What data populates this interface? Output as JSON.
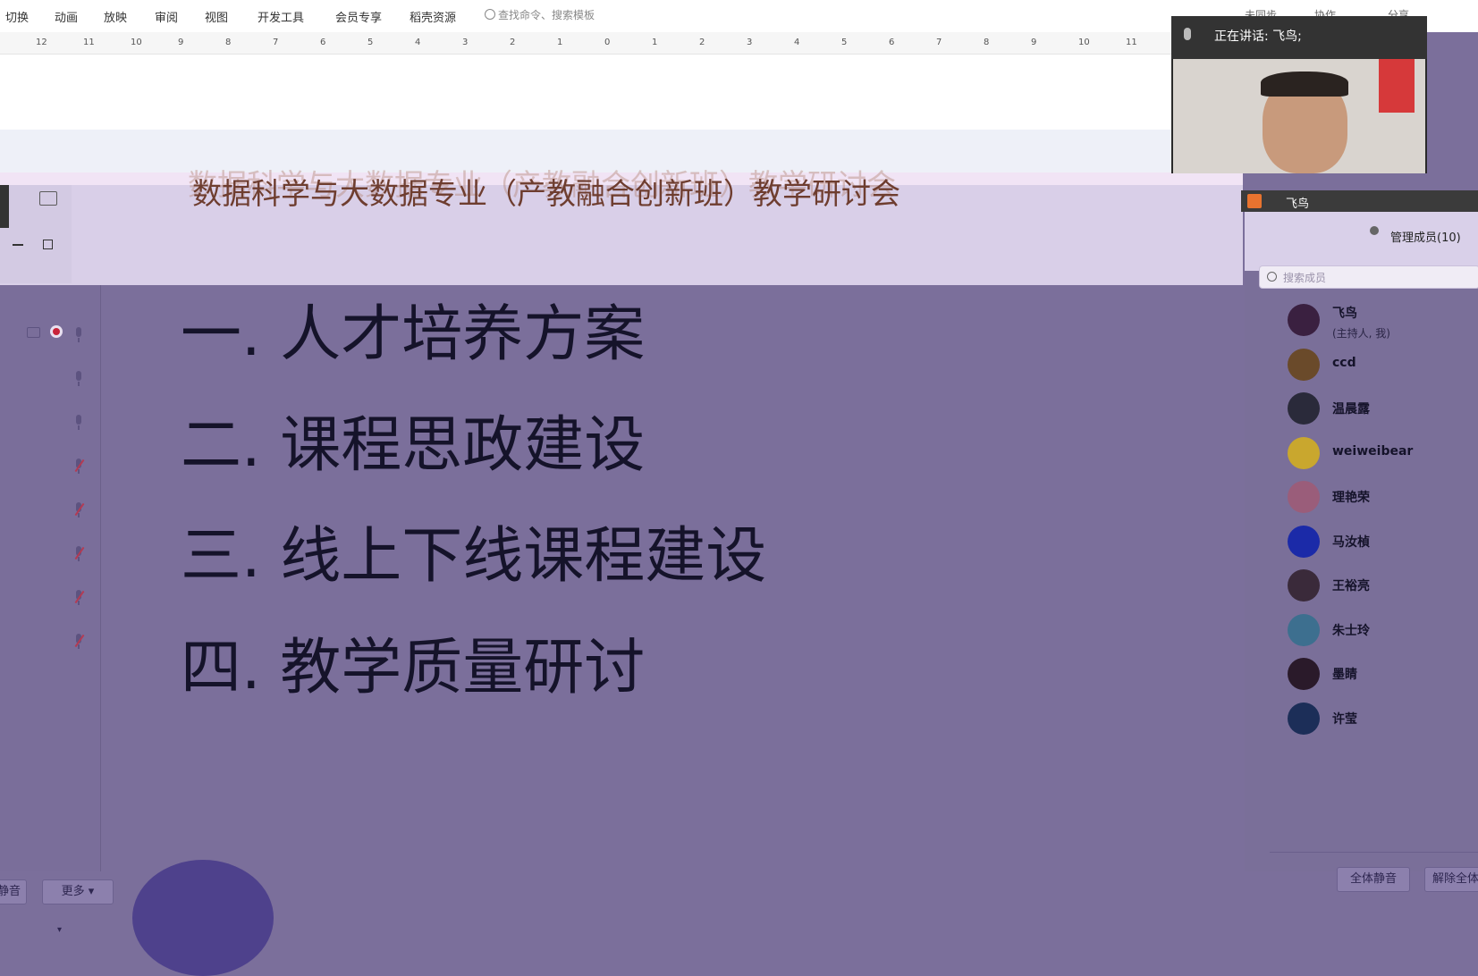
{
  "toolbar": {
    "menu": [
      "切换",
      "动画",
      "放映",
      "审阅",
      "视图",
      "开发工具",
      "会员专享",
      "稻壳资源"
    ],
    "search_placeholder": "查找命令、搜索模板",
    "right_items": [
      "未同步",
      "协作",
      "分享"
    ]
  },
  "ruler": {
    "labels": [
      "12",
      "11",
      "10",
      "9",
      "8",
      "7",
      "6",
      "5",
      "4",
      "3",
      "2",
      "1",
      "0",
      "1",
      "2",
      "3",
      "4",
      "5",
      "6",
      "7",
      "8",
      "9",
      "10",
      "11"
    ]
  },
  "slide": {
    "title": "数据科学与大数据专业（产教融合创新班）教学研讨会",
    "agenda": [
      "一. 人才培养方案",
      "二. 课程思政建设",
      "三. 线上下线课程建设",
      "四. 教学质量研讨"
    ]
  },
  "meeting": {
    "speaking_label": "正在讲话: 飞鸟;",
    "speaker_name": "飞鸟",
    "members_title": "管理成员(10)",
    "member_search_placeholder": "搜索成员",
    "members": [
      {
        "name": "飞鸟",
        "role": "(主持人, 我)",
        "color": "#3a2040"
      },
      {
        "name": "ccd",
        "role": "",
        "color": "#6a4a2a"
      },
      {
        "name": "温晨露",
        "role": "",
        "color": "#2a2a3a"
      },
      {
        "name": "weiweibear",
        "role": "",
        "color": "#c9a72e"
      },
      {
        "name": "理艳荣",
        "role": "",
        "color": "#9a5d7a"
      },
      {
        "name": "马汝楨",
        "role": "",
        "color": "#1b2aa8"
      },
      {
        "name": "王裕亮",
        "role": "",
        "color": "#3a2a3a"
      },
      {
        "name": "朱士玲",
        "role": "",
        "color": "#3d6f8f"
      },
      {
        "name": "墨睛",
        "role": "",
        "color": "#2a1a2a"
      },
      {
        "name": "许莹",
        "role": "",
        "color": "#1c2e58"
      }
    ],
    "bottom_buttons": {
      "mute_left": "静音",
      "more": "更多 ▾",
      "mute_all": "全体静音",
      "unmute_all": "解除全体静音"
    }
  }
}
